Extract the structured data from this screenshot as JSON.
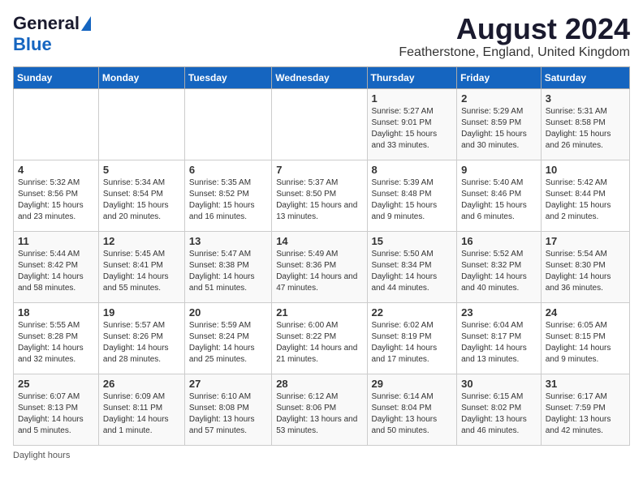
{
  "logo": {
    "line1": "General",
    "line2": "Blue"
  },
  "title": "August 2024",
  "subtitle": "Featherstone, England, United Kingdom",
  "days_of_week": [
    "Sunday",
    "Monday",
    "Tuesday",
    "Wednesday",
    "Thursday",
    "Friday",
    "Saturday"
  ],
  "footer": "Daylight hours",
  "weeks": [
    [
      {
        "day": "",
        "sunrise": "",
        "sunset": "",
        "daylight": ""
      },
      {
        "day": "",
        "sunrise": "",
        "sunset": "",
        "daylight": ""
      },
      {
        "day": "",
        "sunrise": "",
        "sunset": "",
        "daylight": ""
      },
      {
        "day": "",
        "sunrise": "",
        "sunset": "",
        "daylight": ""
      },
      {
        "day": "1",
        "sunrise": "Sunrise: 5:27 AM",
        "sunset": "Sunset: 9:01 PM",
        "daylight": "Daylight: 15 hours and 33 minutes."
      },
      {
        "day": "2",
        "sunrise": "Sunrise: 5:29 AM",
        "sunset": "Sunset: 8:59 PM",
        "daylight": "Daylight: 15 hours and 30 minutes."
      },
      {
        "day": "3",
        "sunrise": "Sunrise: 5:31 AM",
        "sunset": "Sunset: 8:58 PM",
        "daylight": "Daylight: 15 hours and 26 minutes."
      }
    ],
    [
      {
        "day": "4",
        "sunrise": "Sunrise: 5:32 AM",
        "sunset": "Sunset: 8:56 PM",
        "daylight": "Daylight: 15 hours and 23 minutes."
      },
      {
        "day": "5",
        "sunrise": "Sunrise: 5:34 AM",
        "sunset": "Sunset: 8:54 PM",
        "daylight": "Daylight: 15 hours and 20 minutes."
      },
      {
        "day": "6",
        "sunrise": "Sunrise: 5:35 AM",
        "sunset": "Sunset: 8:52 PM",
        "daylight": "Daylight: 15 hours and 16 minutes."
      },
      {
        "day": "7",
        "sunrise": "Sunrise: 5:37 AM",
        "sunset": "Sunset: 8:50 PM",
        "daylight": "Daylight: 15 hours and 13 minutes."
      },
      {
        "day": "8",
        "sunrise": "Sunrise: 5:39 AM",
        "sunset": "Sunset: 8:48 PM",
        "daylight": "Daylight: 15 hours and 9 minutes."
      },
      {
        "day": "9",
        "sunrise": "Sunrise: 5:40 AM",
        "sunset": "Sunset: 8:46 PM",
        "daylight": "Daylight: 15 hours and 6 minutes."
      },
      {
        "day": "10",
        "sunrise": "Sunrise: 5:42 AM",
        "sunset": "Sunset: 8:44 PM",
        "daylight": "Daylight: 15 hours and 2 minutes."
      }
    ],
    [
      {
        "day": "11",
        "sunrise": "Sunrise: 5:44 AM",
        "sunset": "Sunset: 8:42 PM",
        "daylight": "Daylight: 14 hours and 58 minutes."
      },
      {
        "day": "12",
        "sunrise": "Sunrise: 5:45 AM",
        "sunset": "Sunset: 8:41 PM",
        "daylight": "Daylight: 14 hours and 55 minutes."
      },
      {
        "day": "13",
        "sunrise": "Sunrise: 5:47 AM",
        "sunset": "Sunset: 8:38 PM",
        "daylight": "Daylight: 14 hours and 51 minutes."
      },
      {
        "day": "14",
        "sunrise": "Sunrise: 5:49 AM",
        "sunset": "Sunset: 8:36 PM",
        "daylight": "Daylight: 14 hours and 47 minutes."
      },
      {
        "day": "15",
        "sunrise": "Sunrise: 5:50 AM",
        "sunset": "Sunset: 8:34 PM",
        "daylight": "Daylight: 14 hours and 44 minutes."
      },
      {
        "day": "16",
        "sunrise": "Sunrise: 5:52 AM",
        "sunset": "Sunset: 8:32 PM",
        "daylight": "Daylight: 14 hours and 40 minutes."
      },
      {
        "day": "17",
        "sunrise": "Sunrise: 5:54 AM",
        "sunset": "Sunset: 8:30 PM",
        "daylight": "Daylight: 14 hours and 36 minutes."
      }
    ],
    [
      {
        "day": "18",
        "sunrise": "Sunrise: 5:55 AM",
        "sunset": "Sunset: 8:28 PM",
        "daylight": "Daylight: 14 hours and 32 minutes."
      },
      {
        "day": "19",
        "sunrise": "Sunrise: 5:57 AM",
        "sunset": "Sunset: 8:26 PM",
        "daylight": "Daylight: 14 hours and 28 minutes."
      },
      {
        "day": "20",
        "sunrise": "Sunrise: 5:59 AM",
        "sunset": "Sunset: 8:24 PM",
        "daylight": "Daylight: 14 hours and 25 minutes."
      },
      {
        "day": "21",
        "sunrise": "Sunrise: 6:00 AM",
        "sunset": "Sunset: 8:22 PM",
        "daylight": "Daylight: 14 hours and 21 minutes."
      },
      {
        "day": "22",
        "sunrise": "Sunrise: 6:02 AM",
        "sunset": "Sunset: 8:19 PM",
        "daylight": "Daylight: 14 hours and 17 minutes."
      },
      {
        "day": "23",
        "sunrise": "Sunrise: 6:04 AM",
        "sunset": "Sunset: 8:17 PM",
        "daylight": "Daylight: 14 hours and 13 minutes."
      },
      {
        "day": "24",
        "sunrise": "Sunrise: 6:05 AM",
        "sunset": "Sunset: 8:15 PM",
        "daylight": "Daylight: 14 hours and 9 minutes."
      }
    ],
    [
      {
        "day": "25",
        "sunrise": "Sunrise: 6:07 AM",
        "sunset": "Sunset: 8:13 PM",
        "daylight": "Daylight: 14 hours and 5 minutes."
      },
      {
        "day": "26",
        "sunrise": "Sunrise: 6:09 AM",
        "sunset": "Sunset: 8:11 PM",
        "daylight": "Daylight: 14 hours and 1 minute."
      },
      {
        "day": "27",
        "sunrise": "Sunrise: 6:10 AM",
        "sunset": "Sunset: 8:08 PM",
        "daylight": "Daylight: 13 hours and 57 minutes."
      },
      {
        "day": "28",
        "sunrise": "Sunrise: 6:12 AM",
        "sunset": "Sunset: 8:06 PM",
        "daylight": "Daylight: 13 hours and 53 minutes."
      },
      {
        "day": "29",
        "sunrise": "Sunrise: 6:14 AM",
        "sunset": "Sunset: 8:04 PM",
        "daylight": "Daylight: 13 hours and 50 minutes."
      },
      {
        "day": "30",
        "sunrise": "Sunrise: 6:15 AM",
        "sunset": "Sunset: 8:02 PM",
        "daylight": "Daylight: 13 hours and 46 minutes."
      },
      {
        "day": "31",
        "sunrise": "Sunrise: 6:17 AM",
        "sunset": "Sunset: 7:59 PM",
        "daylight": "Daylight: 13 hours and 42 minutes."
      }
    ]
  ]
}
